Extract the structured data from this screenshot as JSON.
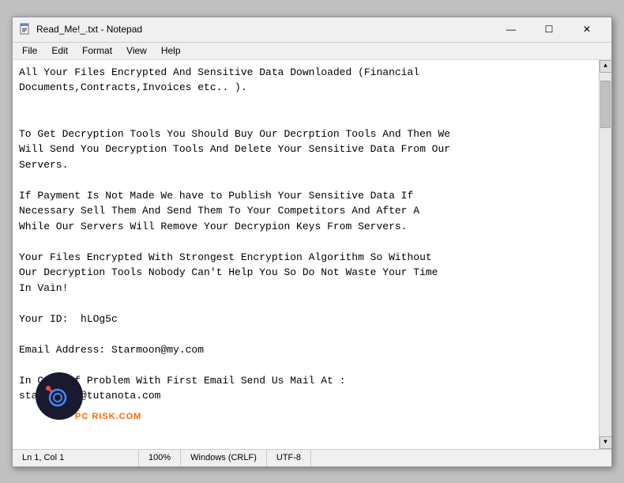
{
  "window": {
    "title": "Read_Me!_.txt - Notepad",
    "icon": "notepad"
  },
  "titlebar": {
    "minimize_label": "—",
    "maximize_label": "☐",
    "close_label": "✕"
  },
  "menubar": {
    "items": [
      {
        "id": "file",
        "label": "File"
      },
      {
        "id": "edit",
        "label": "Edit"
      },
      {
        "id": "format",
        "label": "Format"
      },
      {
        "id": "view",
        "label": "View"
      },
      {
        "id": "help",
        "label": "Help"
      }
    ]
  },
  "content": {
    "text": "All Your Files Encrypted And Sensitive Data Downloaded (Financial\nDocuments,Contracts,Invoices etc.. ).\n\n\nTo Get Decryption Tools You Should Buy Our Decrption Tools And Then We\nWill Send You Decryption Tools And Delete Your Sensitive Data From Our\nServers.\n\nIf Payment Is Not Made We have to Publish Your Sensitive Data If\nNecessary Sell Them And Send Them To Your Competitors And After A\nWhile Our Servers Will Remove Your Decrypion Keys From Servers.\n\nYour Files Encrypted With Strongest Encryption Algorithm So Without\nOur Decryption Tools Nobody Can't Help You So Do Not Waste Your Time\nIn Vain!\n\nYour ID:  hLOg5c\n\nEmail Address: Starmoon@my.com\n\nIn Case Of Problem With First Email Send Us Mail At :\nstarmoon1c@tutanota.com"
  },
  "statusbar": {
    "line_col": "Ln 1, Col 1",
    "zoom": "100%",
    "line_ending": "Windows (CRLF)",
    "encoding": "UTF-8"
  },
  "watermark": {
    "text": "PC RISK.COM"
  }
}
